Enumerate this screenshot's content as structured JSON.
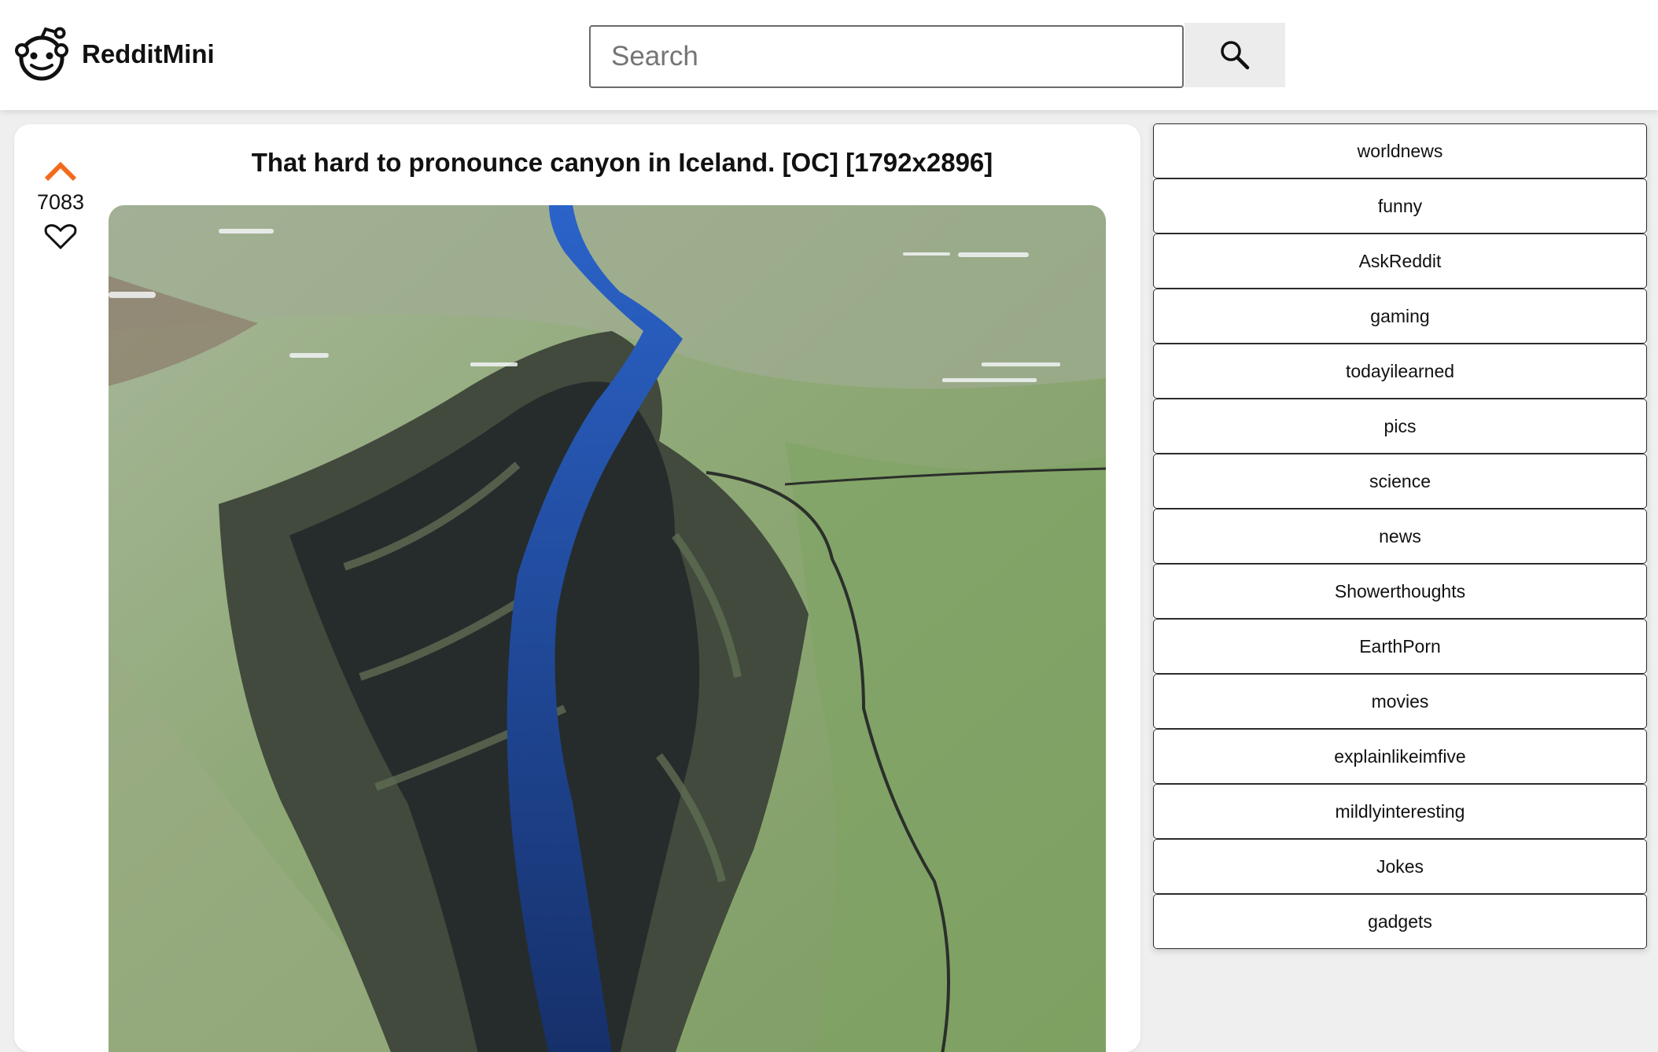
{
  "header": {
    "app_title": "RedditMini",
    "search": {
      "placeholder": "Search",
      "value": ""
    },
    "logo_icon": "reddit-alien-icon",
    "search_icon": "magnifier-icon"
  },
  "post": {
    "title": "That hard to pronounce canyon in Iceland. [OC] [1792x2896]",
    "score": "7083",
    "upvote_icon": "chevron-up-icon",
    "downvote_icon": "heart-outline-icon",
    "upvote_color": "#f26b1d",
    "image_subject": "aerial photo of a canyon"
  },
  "sidebar": {
    "subreddits": [
      {
        "label": "worldnews"
      },
      {
        "label": "funny"
      },
      {
        "label": "AskReddit"
      },
      {
        "label": "gaming"
      },
      {
        "label": "todayilearned"
      },
      {
        "label": "pics"
      },
      {
        "label": "science"
      },
      {
        "label": "news"
      },
      {
        "label": "Showerthoughts"
      },
      {
        "label": "EarthPorn"
      },
      {
        "label": "movies"
      },
      {
        "label": "explainlikeimfive"
      },
      {
        "label": "mildlyinteresting"
      },
      {
        "label": "Jokes"
      },
      {
        "label": "gadgets"
      }
    ]
  }
}
